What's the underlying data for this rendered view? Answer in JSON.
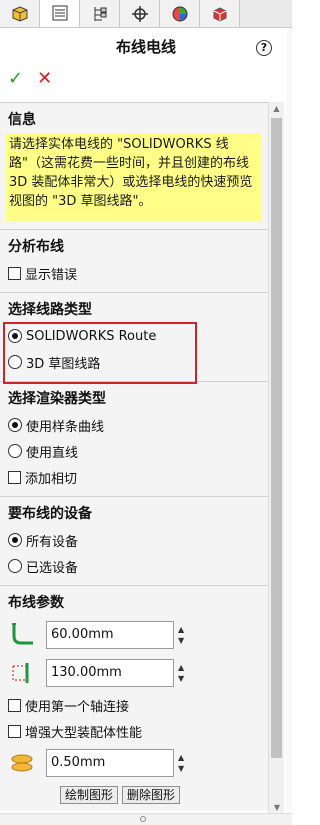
{
  "tabs": [
    {
      "icon": "feature-manager-icon"
    },
    {
      "icon": "property-manager-icon"
    },
    {
      "icon": "configuration-manager-icon"
    },
    {
      "icon": "dimxpert-icon"
    },
    {
      "icon": "display-manager-icon"
    },
    {
      "icon": "add-in-icon"
    }
  ],
  "header": {
    "title": "布线电线",
    "help": "?"
  },
  "actions": {
    "ok": "✓",
    "cancel": "✕"
  },
  "info": {
    "heading": "信息",
    "text": "请选择实体电线的 \"SOLIDWORKS 线路\"（这需花费一些时间，并且创建的布线 3D 装配体非常大）或选择电线的快速预览视图的 \"3D 草图线路\"。"
  },
  "analysis": {
    "heading": "分析布线",
    "show_errors": "显示错误"
  },
  "route_type": {
    "heading": "选择线路类型",
    "options": [
      "SOLIDWORKS Route",
      "3D 草图线路"
    ],
    "selected": 0
  },
  "renderer": {
    "heading": "选择渲染器类型",
    "options": [
      "使用样条曲线",
      "使用直线"
    ],
    "selected": 0,
    "add_tangent": "添加相切"
  },
  "devices": {
    "heading": "要布线的设备",
    "options": [
      "所有设备",
      "已选设备"
    ],
    "selected": 0
  },
  "params": {
    "heading": "布线参数",
    "first_value": "60.00mm",
    "second_value": "130.00mm",
    "use_first_axis": "使用第一个轴连接",
    "large_assembly": "增强大型装配体性能",
    "third_value": "0.50mm",
    "draw_button": "绘制图形",
    "delete_button": "删除图形"
  },
  "colors": {
    "highlight": "#c8262a",
    "info_bg": "#ffff88",
    "ok": "#2b9a2b",
    "cancel": "#c8261f"
  }
}
